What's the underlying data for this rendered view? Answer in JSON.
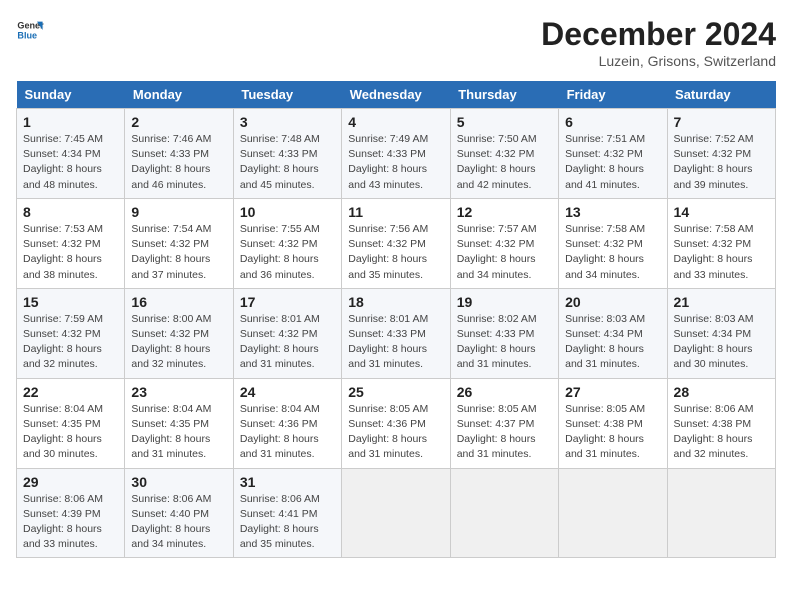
{
  "logo": {
    "line1": "General",
    "line2": "Blue"
  },
  "title": "December 2024",
  "location": "Luzein, Grisons, Switzerland",
  "days_of_week": [
    "Sunday",
    "Monday",
    "Tuesday",
    "Wednesday",
    "Thursday",
    "Friday",
    "Saturday"
  ],
  "weeks": [
    [
      {
        "day": "1",
        "sunrise": "7:45 AM",
        "sunset": "4:34 PM",
        "daylight": "8 hours and 48 minutes."
      },
      {
        "day": "2",
        "sunrise": "7:46 AM",
        "sunset": "4:33 PM",
        "daylight": "8 hours and 46 minutes."
      },
      {
        "day": "3",
        "sunrise": "7:48 AM",
        "sunset": "4:33 PM",
        "daylight": "8 hours and 45 minutes."
      },
      {
        "day": "4",
        "sunrise": "7:49 AM",
        "sunset": "4:33 PM",
        "daylight": "8 hours and 43 minutes."
      },
      {
        "day": "5",
        "sunrise": "7:50 AM",
        "sunset": "4:32 PM",
        "daylight": "8 hours and 42 minutes."
      },
      {
        "day": "6",
        "sunrise": "7:51 AM",
        "sunset": "4:32 PM",
        "daylight": "8 hours and 41 minutes."
      },
      {
        "day": "7",
        "sunrise": "7:52 AM",
        "sunset": "4:32 PM",
        "daylight": "8 hours and 39 minutes."
      }
    ],
    [
      {
        "day": "8",
        "sunrise": "7:53 AM",
        "sunset": "4:32 PM",
        "daylight": "8 hours and 38 minutes."
      },
      {
        "day": "9",
        "sunrise": "7:54 AM",
        "sunset": "4:32 PM",
        "daylight": "8 hours and 37 minutes."
      },
      {
        "day": "10",
        "sunrise": "7:55 AM",
        "sunset": "4:32 PM",
        "daylight": "8 hours and 36 minutes."
      },
      {
        "day": "11",
        "sunrise": "7:56 AM",
        "sunset": "4:32 PM",
        "daylight": "8 hours and 35 minutes."
      },
      {
        "day": "12",
        "sunrise": "7:57 AM",
        "sunset": "4:32 PM",
        "daylight": "8 hours and 34 minutes."
      },
      {
        "day": "13",
        "sunrise": "7:58 AM",
        "sunset": "4:32 PM",
        "daylight": "8 hours and 34 minutes."
      },
      {
        "day": "14",
        "sunrise": "7:58 AM",
        "sunset": "4:32 PM",
        "daylight": "8 hours and 33 minutes."
      }
    ],
    [
      {
        "day": "15",
        "sunrise": "7:59 AM",
        "sunset": "4:32 PM",
        "daylight": "8 hours and 32 minutes."
      },
      {
        "day": "16",
        "sunrise": "8:00 AM",
        "sunset": "4:32 PM",
        "daylight": "8 hours and 32 minutes."
      },
      {
        "day": "17",
        "sunrise": "8:01 AM",
        "sunset": "4:32 PM",
        "daylight": "8 hours and 31 minutes."
      },
      {
        "day": "18",
        "sunrise": "8:01 AM",
        "sunset": "4:33 PM",
        "daylight": "8 hours and 31 minutes."
      },
      {
        "day": "19",
        "sunrise": "8:02 AM",
        "sunset": "4:33 PM",
        "daylight": "8 hours and 31 minutes."
      },
      {
        "day": "20",
        "sunrise": "8:03 AM",
        "sunset": "4:34 PM",
        "daylight": "8 hours and 31 minutes."
      },
      {
        "day": "21",
        "sunrise": "8:03 AM",
        "sunset": "4:34 PM",
        "daylight": "8 hours and 30 minutes."
      }
    ],
    [
      {
        "day": "22",
        "sunrise": "8:04 AM",
        "sunset": "4:35 PM",
        "daylight": "8 hours and 30 minutes."
      },
      {
        "day": "23",
        "sunrise": "8:04 AM",
        "sunset": "4:35 PM",
        "daylight": "8 hours and 31 minutes."
      },
      {
        "day": "24",
        "sunrise": "8:04 AM",
        "sunset": "4:36 PM",
        "daylight": "8 hours and 31 minutes."
      },
      {
        "day": "25",
        "sunrise": "8:05 AM",
        "sunset": "4:36 PM",
        "daylight": "8 hours and 31 minutes."
      },
      {
        "day": "26",
        "sunrise": "8:05 AM",
        "sunset": "4:37 PM",
        "daylight": "8 hours and 31 minutes."
      },
      {
        "day": "27",
        "sunrise": "8:05 AM",
        "sunset": "4:38 PM",
        "daylight": "8 hours and 31 minutes."
      },
      {
        "day": "28",
        "sunrise": "8:06 AM",
        "sunset": "4:38 PM",
        "daylight": "8 hours and 32 minutes."
      }
    ],
    [
      {
        "day": "29",
        "sunrise": "8:06 AM",
        "sunset": "4:39 PM",
        "daylight": "8 hours and 33 minutes."
      },
      {
        "day": "30",
        "sunrise": "8:06 AM",
        "sunset": "4:40 PM",
        "daylight": "8 hours and 34 minutes."
      },
      {
        "day": "31",
        "sunrise": "8:06 AM",
        "sunset": "4:41 PM",
        "daylight": "8 hours and 35 minutes."
      },
      null,
      null,
      null,
      null
    ]
  ]
}
